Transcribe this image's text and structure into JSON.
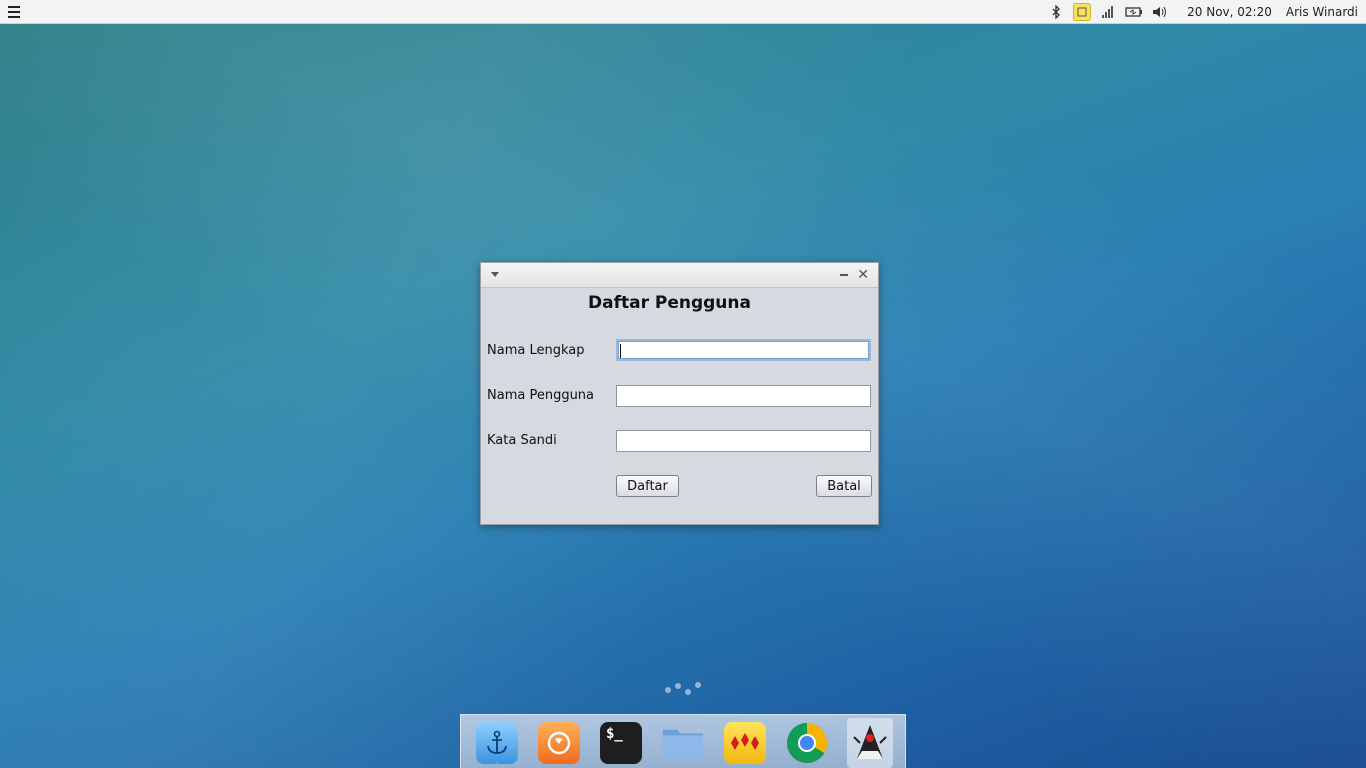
{
  "panel": {
    "clock": "20 Nov, 02:20",
    "user": "Aris Winardi",
    "tray_icons": [
      "bluetooth-icon",
      "sticky-note-icon",
      "signal-icon",
      "battery-icon",
      "volume-icon"
    ]
  },
  "dialog": {
    "title": "Daftar Pengguna",
    "fields": [
      {
        "label": "Nama Lengkap",
        "value": ""
      },
      {
        "label": "Nama Pengguna",
        "value": ""
      },
      {
        "label": "Kata Sandi",
        "value": ""
      }
    ],
    "buttons": {
      "register": "Daftar",
      "cancel": "Batal"
    }
  },
  "dock": {
    "items": [
      "anchor-icon",
      "firefox-icon",
      "terminal-icon",
      "folder-icon",
      "cards-game-icon",
      "chrome-icon",
      "java-duke-icon"
    ],
    "terminal_glyph": "$_"
  }
}
